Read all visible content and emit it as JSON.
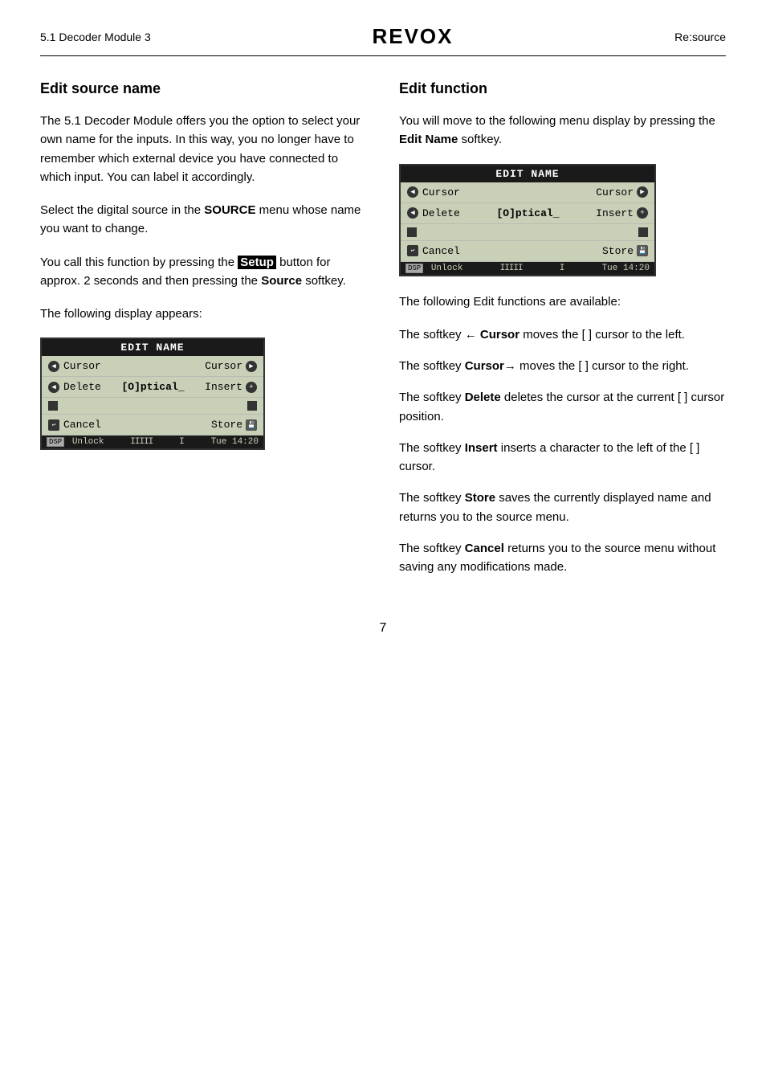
{
  "header": {
    "left": "5.1 Decoder Module 3",
    "logo": "REVOX",
    "right": "Re:source"
  },
  "left_column": {
    "heading": "Edit source name",
    "para1": "The 5.1 Decoder Module offers you the option to select your own name for the inputs. In this way, you no longer have to remember which external device you have connected to which input. You can label it accordingly.",
    "para2_prefix": "Select the digital source in the ",
    "para2_bold": "SOURCE",
    "para2_suffix": " menu whose name you want to change.",
    "para3_prefix": "You call this function by pressing the ",
    "para3_bold": "Setup",
    "para3_suffix": " button for approx. 2 seconds and then pressing the ",
    "para3_bold2": "Source",
    "para3_suffix2": " softkey.",
    "para4": "The following display appears:",
    "lcd": {
      "title": "EDIT NAME",
      "row1_left": "Cursor",
      "row1_right": "Cursor",
      "row2_left": "Delete",
      "row2_center": "[O]ptical_",
      "row2_right": "Insert",
      "row3_left": "",
      "row3_right": "",
      "row4_left": "Cancel",
      "row4_right": "Store",
      "bottom_badge": "DSP",
      "bottom_text": "Unlock",
      "bottom_bars": "IIIII",
      "bottom_sep": "I",
      "bottom_time": "Tue 14:20"
    }
  },
  "right_column": {
    "heading": "Edit function",
    "para1": "You will move to the following menu display by pressing the ",
    "para1_bold": "Edit Name",
    "para1_suffix": " softkey.",
    "lcd": {
      "title": "EDIT NAME",
      "row1_left": "Cursor",
      "row1_right": "Cursor",
      "row2_left": "Delete",
      "row2_center": "[O]ptical_",
      "row2_right": "Insert",
      "row3_left": "",
      "row3_right": "",
      "row4_left": "Cancel",
      "row4_right": "Store",
      "bottom_badge": "DSP",
      "bottom_text": "Unlock",
      "bottom_bars": "IIIII",
      "bottom_sep": "I",
      "bottom_time": "Tue 14:20"
    },
    "functions_intro": "The following Edit functions are available:",
    "softkeys": [
      {
        "key_prefix": "The softkey ",
        "key_arrow": "←",
        "key_bold": " Cursor",
        "key_suffix": " moves the [  ] cursor to the left."
      },
      {
        "key_prefix": "The softkey ",
        "key_bold": "Cursor",
        "key_arrow": "→",
        "key_suffix": " moves the [  ] cursor to the right."
      },
      {
        "key_prefix": "The softkey ",
        "key_bold": "Delete",
        "key_suffix": " deletes the cursor at the current [  ] cursor position."
      },
      {
        "key_prefix": "The softkey ",
        "key_bold": "Insert",
        "key_suffix": " inserts a character to the left of the [  ] cursor."
      },
      {
        "key_prefix": "The softkey ",
        "key_bold": "Store",
        "key_suffix": " saves the currently displayed name and returns you to the source menu."
      },
      {
        "key_prefix": "The softkey ",
        "key_bold": "Cancel",
        "key_suffix": " returns you to the source menu without saving any modifications made."
      }
    ]
  },
  "page_number": "7"
}
